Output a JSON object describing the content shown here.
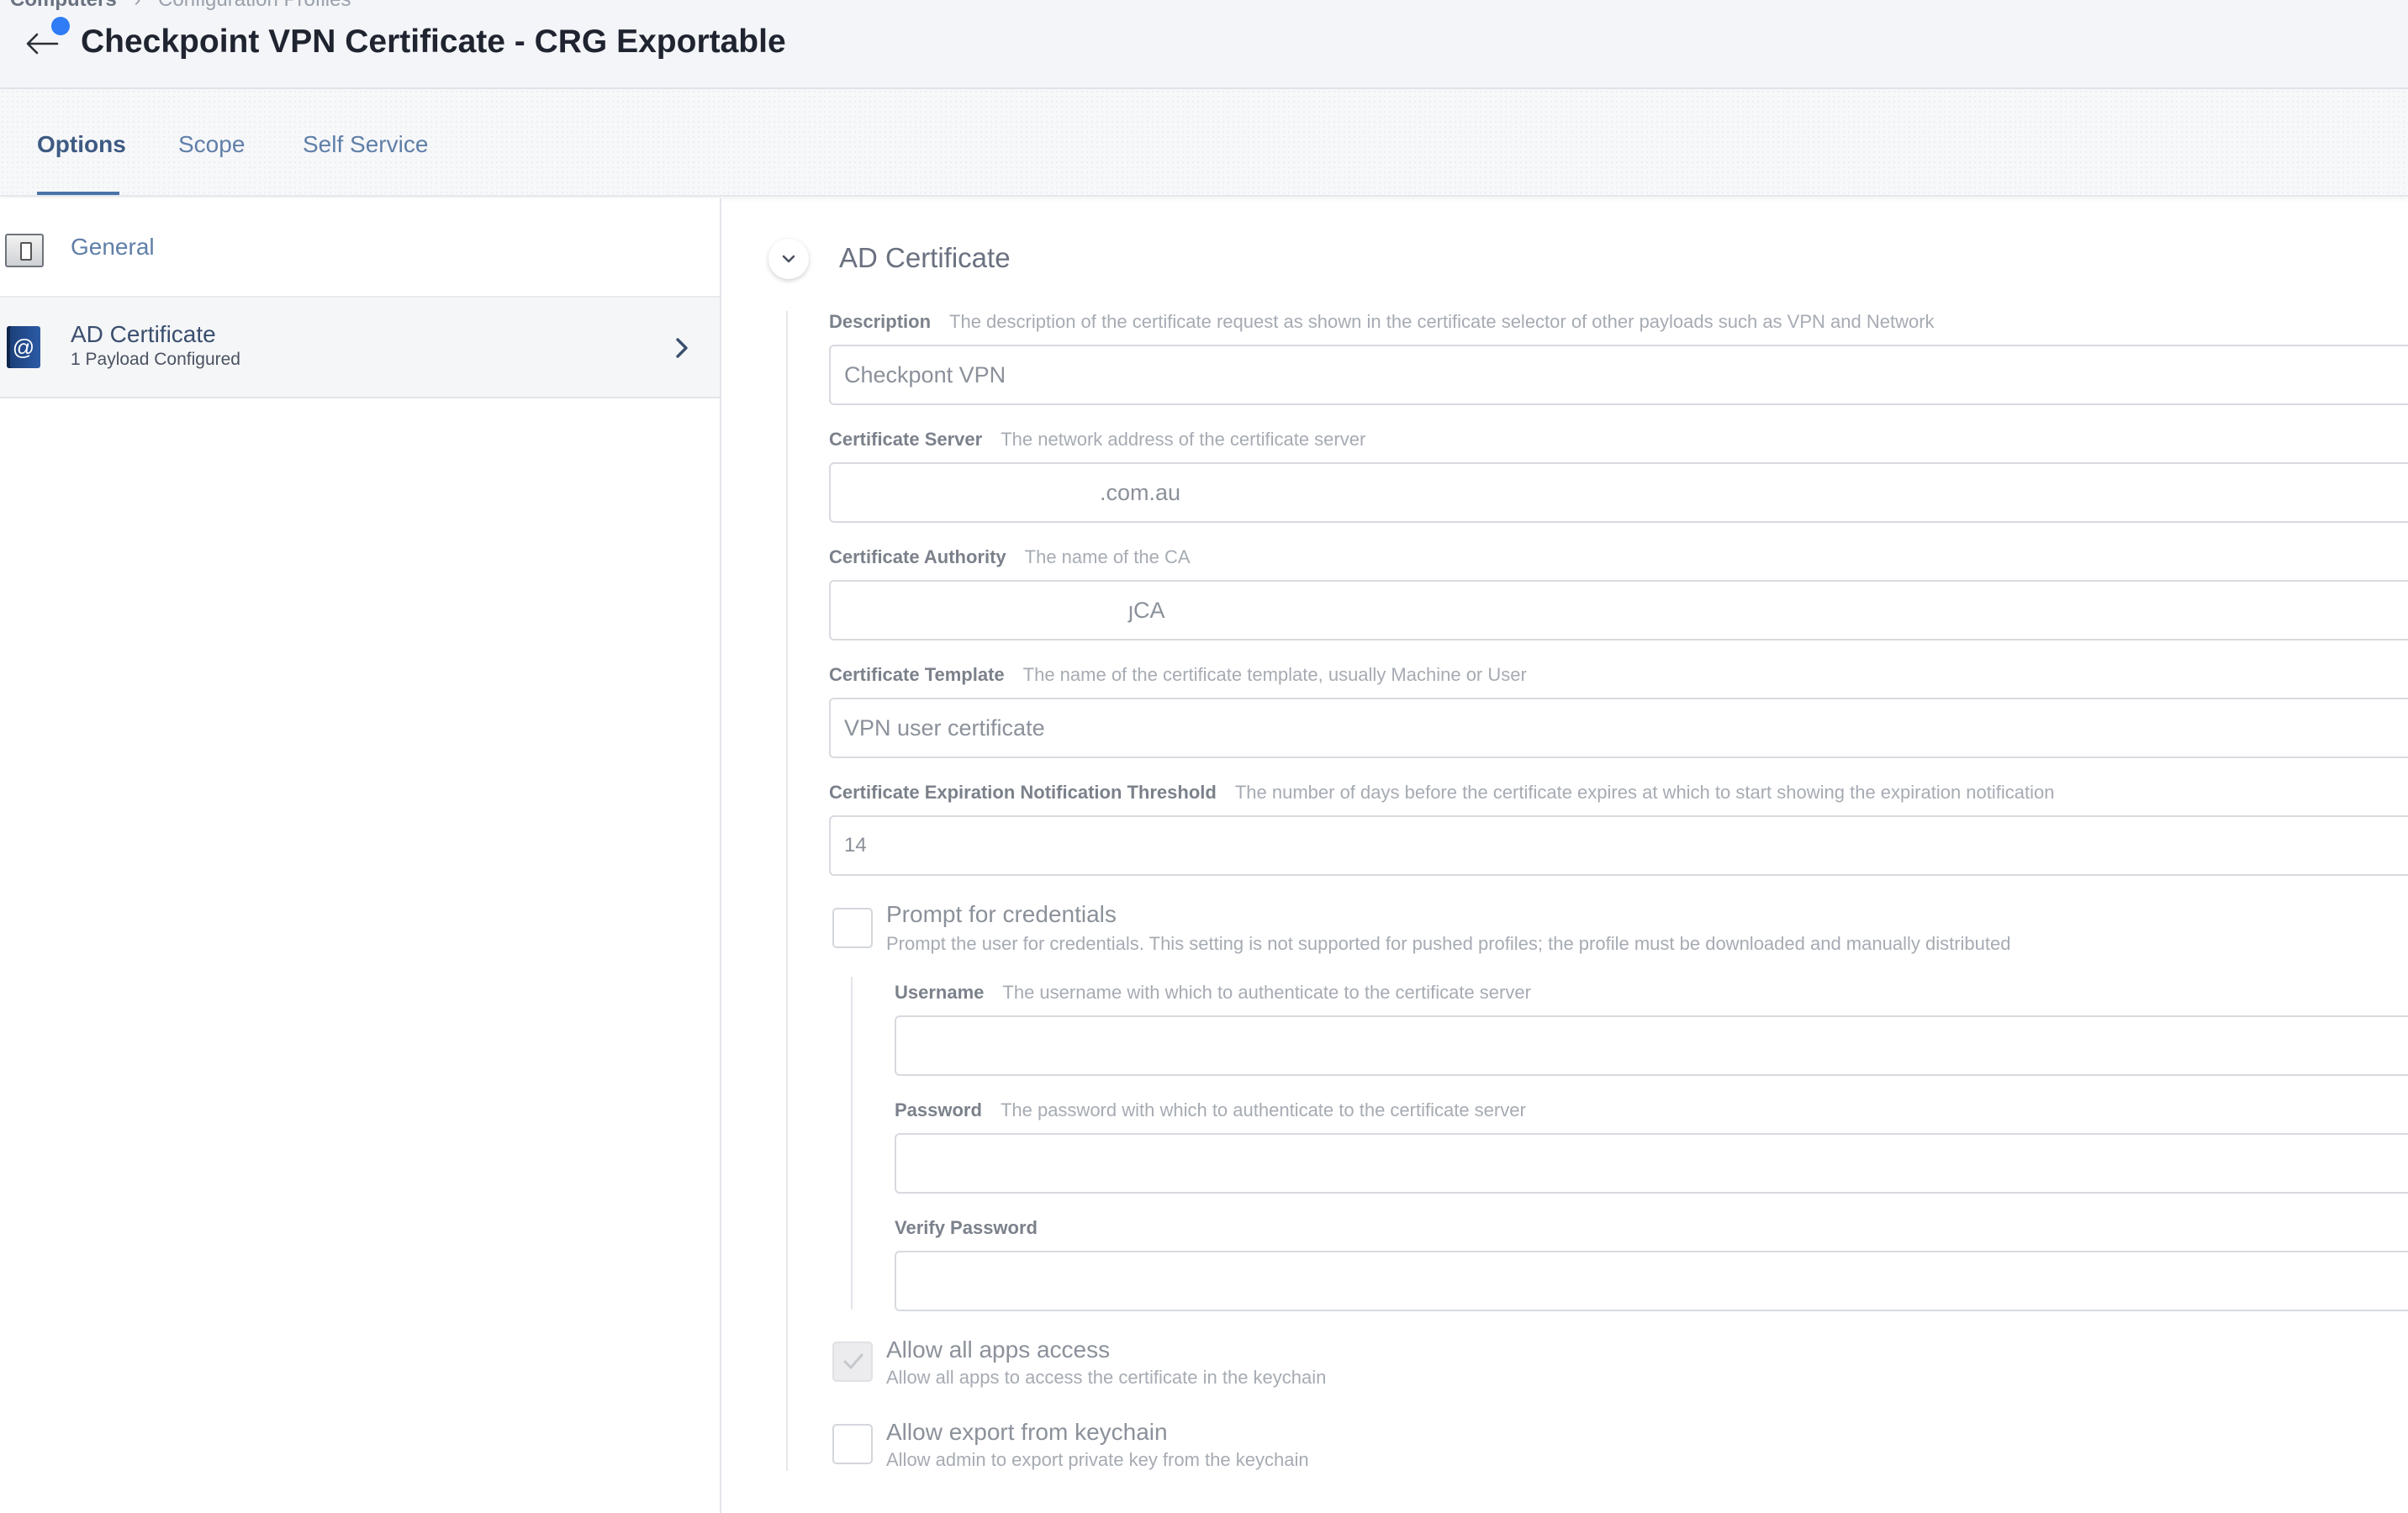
{
  "breadcrumb": {
    "items": [
      "Computers",
      "Configuration Profiles"
    ],
    "separator": "›"
  },
  "header": {
    "title": "Checkpoint VPN Certificate - CRG Exportable"
  },
  "tabs": [
    {
      "label": "Options",
      "active": true
    },
    {
      "label": "Scope",
      "active": false
    },
    {
      "label": "Self Service",
      "active": false
    }
  ],
  "sidebar": {
    "items": [
      {
        "label": "General",
        "icon": "general-icon"
      },
      {
        "label": "AD Certificate",
        "sublabel": "1 Payload Configured",
        "icon": "certificate-icon",
        "selected": true
      }
    ]
  },
  "section": {
    "title": "AD Certificate",
    "fields": {
      "description": {
        "label": "Description",
        "help": "The description of the certificate request as shown in the certificate selector of other payloads such as VPN and Network",
        "value": "Checkpont VPN"
      },
      "certificate_server": {
        "label": "Certificate Server",
        "help": "The network address of the certificate server",
        "value": ".com.au"
      },
      "certificate_authority": {
        "label": "Certificate Authority",
        "help": "The name of the CA",
        "value": "ȷCA"
      },
      "certificate_template": {
        "label": "Certificate Template",
        "help": "The name of the certificate template, usually Machine or User",
        "value": "VPN user certificate"
      },
      "expiration_threshold": {
        "label": "Certificate Expiration Notification Threshold",
        "help": "The number of days before the certificate expires at which to start showing the expiration notification",
        "value": "14"
      },
      "prompt_credentials": {
        "label": "Prompt for credentials",
        "help": "Prompt the user for credentials. This setting is not supported for pushed profiles; the profile must be downloaded and manually distributed",
        "checked": false
      },
      "username": {
        "label": "Username",
        "help": "The username with which to authenticate to the certificate server",
        "value": ""
      },
      "password": {
        "label": "Password",
        "help": "The password with which to authenticate to the certificate server",
        "value": ""
      },
      "verify_password": {
        "label": "Verify Password",
        "help": "",
        "value": ""
      },
      "allow_all_apps": {
        "label": "Allow all apps access",
        "help": "Allow all apps to access the certificate in the keychain",
        "checked": true
      },
      "allow_export": {
        "label": "Allow export from keychain",
        "help": "Allow admin to export private key from the keychain",
        "checked": false
      }
    }
  },
  "colors": {
    "accent": "#4a74a8",
    "notification_dot": "#2f7cf6",
    "tab_active": "#3d5a82"
  }
}
